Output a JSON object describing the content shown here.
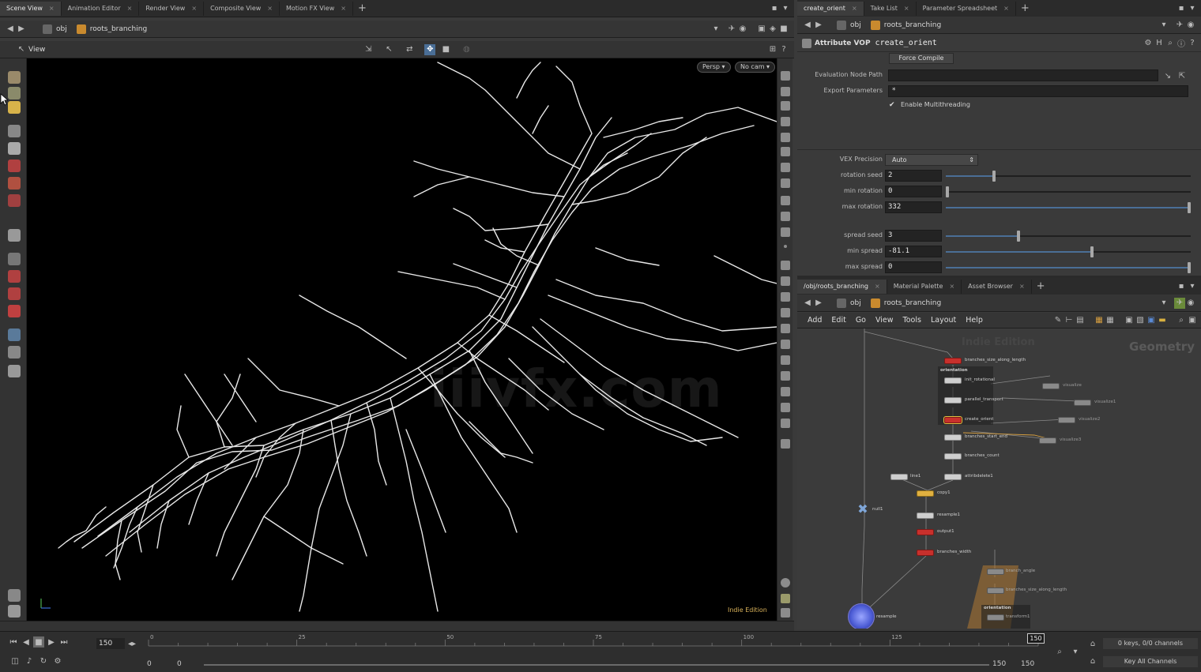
{
  "left_tabs": [
    {
      "label": "Scene View",
      "active": true
    },
    {
      "label": "Animation Editor"
    },
    {
      "label": "Render View"
    },
    {
      "label": "Composite View"
    },
    {
      "label": "Motion FX View"
    }
  ],
  "right_top_tabs": [
    {
      "label": "create_orient",
      "active": true
    },
    {
      "label": "Take List"
    },
    {
      "label": "Parameter Spreadsheet"
    }
  ],
  "path": {
    "root": "obj",
    "node": "roots_branching"
  },
  "viewer": {
    "title": "View",
    "persp_label": "Persp",
    "cam_label": "No cam",
    "edition": "Indie Edition",
    "watermark": "iiivfx.com"
  },
  "params": {
    "header_type": "Attribute VOP",
    "header_name": "create_orient",
    "force_compile": "Force Compile",
    "eval_label": "Evaluation Node Path",
    "export_label": "Export Parameters",
    "export_value": "*",
    "multithread_label": "Enable Multithreading",
    "vex_label": "VEX Precision",
    "vex_value": "Auto",
    "rows": [
      {
        "label": "rotation seed",
        "value": "2",
        "fraction": 0.19
      },
      {
        "label": "min rotation",
        "value": "0",
        "fraction": 0.0
      },
      {
        "label": "max rotation",
        "value": "332",
        "fraction": 1.0
      },
      {
        "label": "spread seed",
        "value": "3",
        "fraction": 0.29
      },
      {
        "label": "min spread",
        "value": "-81.1",
        "fraction": 0.59
      },
      {
        "label": "max spread",
        "value": "0",
        "fraction": 1.0
      }
    ]
  },
  "network_tabs": [
    {
      "label": "/obj/roots_branching",
      "active": true
    },
    {
      "label": "Material Palette"
    },
    {
      "label": "Asset Browser"
    }
  ],
  "network_menu": [
    "Add",
    "Edit",
    "Go",
    "View",
    "Tools",
    "Layout",
    "Help"
  ],
  "network": {
    "context": "Geometry",
    "context_faint": "Indie Edition",
    "nodes": [
      {
        "label": "branches_size_along_length",
        "kind": "red"
      },
      {
        "label": "orientation",
        "kind": "label"
      },
      {
        "label": "init_rotational",
        "kind": "white"
      },
      {
        "label": "parallel_transport",
        "kind": "white"
      },
      {
        "label": "create_orient",
        "kind": "red"
      },
      {
        "label": "branches_start_end",
        "kind": "white"
      },
      {
        "label": "branches_count",
        "kind": "white"
      },
      {
        "label": "attribdelete1",
        "kind": "white"
      },
      {
        "label": "line1",
        "kind": "white"
      },
      {
        "label": "copy1",
        "kind": "yellow"
      },
      {
        "label": "resample1",
        "kind": "white"
      },
      {
        "label": "output1",
        "kind": "red"
      },
      {
        "label": "branches_width",
        "kind": "red"
      },
      {
        "label": "null1",
        "kind": "blue"
      },
      {
        "label": "resample",
        "kind": "blue-round"
      },
      {
        "label": "visualize",
        "kind": "grey"
      },
      {
        "label": "visualize1",
        "kind": "grey"
      },
      {
        "label": "visualize2",
        "kind": "grey"
      },
      {
        "label": "visualize3",
        "kind": "grey"
      },
      {
        "label": "branch_angle",
        "kind": "grey"
      },
      {
        "label": "branches_size_along_length",
        "kind": "grey"
      },
      {
        "label": "orientation",
        "kind": "label"
      },
      {
        "label": "transform1",
        "kind": "grey"
      }
    ]
  },
  "timeline": {
    "frame": "150",
    "start": "0",
    "start2": "0",
    "end": "150",
    "end2": "150",
    "marker": "150",
    "ticks": [
      "0",
      "25",
      "50",
      "75",
      "100",
      "125"
    ],
    "keys_label": "0 keys, 0/0 channels",
    "key_all": "Key All Channels"
  },
  "colors": {
    "accent_blue": "#4a6e96",
    "node_red": "#c8302c",
    "node_yellow": "#e0b040",
    "viewport_bg": "#000000",
    "roots": "#e8e8e8"
  }
}
